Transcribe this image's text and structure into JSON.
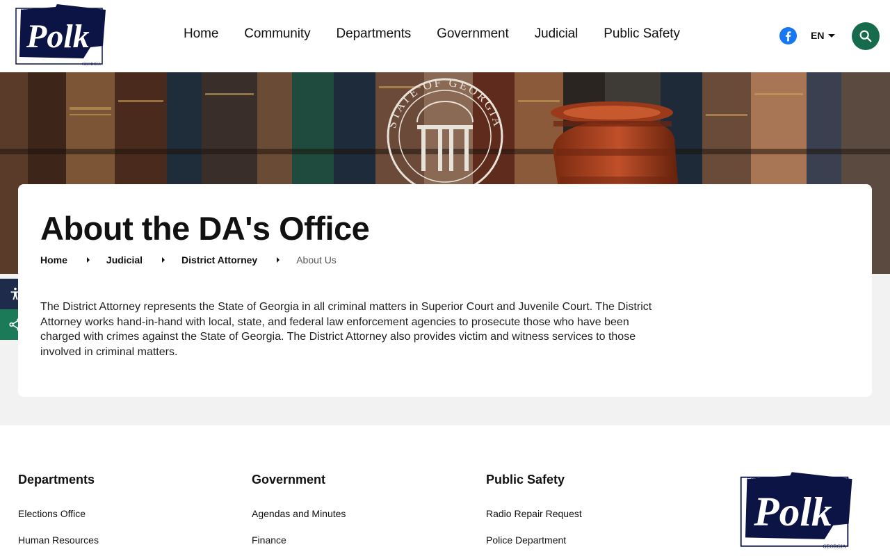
{
  "header": {
    "logo": {
      "est": "EST. 1851",
      "name": "Polk",
      "state": "GEORGIA"
    },
    "nav": [
      "Home",
      "Community",
      "Departments",
      "Government",
      "Judicial",
      "Public Safety"
    ],
    "language": "EN"
  },
  "hero": {
    "seal_text": "STATE OF GEORGIA"
  },
  "page": {
    "title": "About the DA's Office",
    "breadcrumb": [
      "Home",
      "Judicial",
      "District Attorney"
    ],
    "breadcrumb_current": "About Us",
    "body": "The District Attorney represents the State of Georgia in all criminal matters in Superior Court and Juvenile Court. The District Attorney works hand-in-hand with local, state, and federal law enforcement agencies to prosecute those who have been charged with crimes against the State of Georgia. The District Attorney also provides victim and witness services to those involved in criminal matters."
  },
  "footer": {
    "columns": [
      {
        "heading": "Departments",
        "links": [
          "Elections Office",
          "Human Resources"
        ]
      },
      {
        "heading": "Government",
        "links": [
          "Agendas and Minutes",
          "Finance"
        ]
      },
      {
        "heading": "Public Safety",
        "links": [
          "Radio Repair Request",
          "Police Department"
        ]
      }
    ]
  },
  "colors": {
    "navy": "#0c1445",
    "accent_green": "#176b4d",
    "share_green": "#1b7a57",
    "facebook": "#1877f2"
  },
  "icons": [
    "facebook-icon",
    "chevron-down-icon",
    "search-icon",
    "accessibility-icon",
    "share-icon"
  ]
}
